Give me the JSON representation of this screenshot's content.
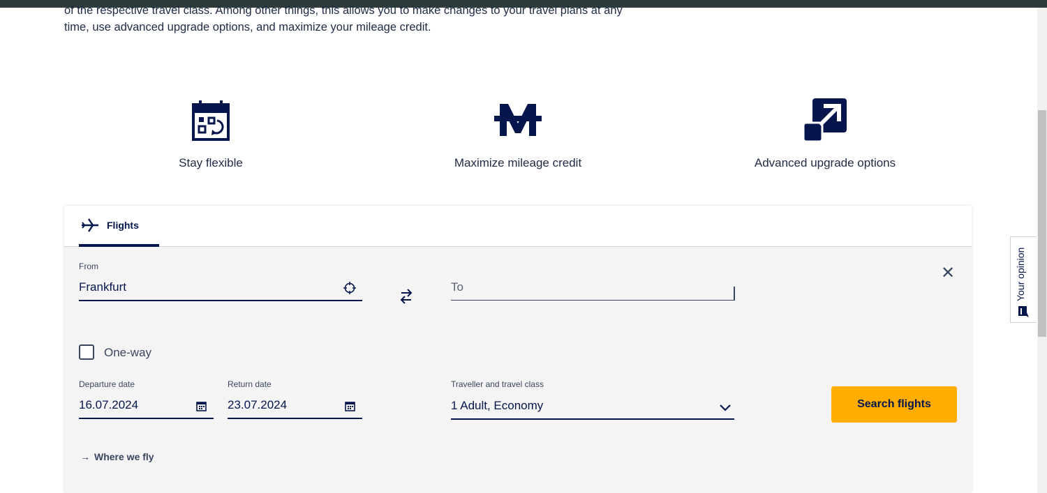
{
  "intro_text_line1": "of the respective travel class. Among other things, this allows you to make changes to your travel plans at any",
  "intro_text_line2": "time, use advanced upgrade options, and maximize your mileage credit.",
  "benefits": [
    {
      "label": "Stay flexible",
      "icon": "calendar-flex-icon"
    },
    {
      "label": "Maximize mileage credit",
      "icon": "miles-m-icon"
    },
    {
      "label": "Advanced upgrade options",
      "icon": "upgrade-arrow-icon"
    }
  ],
  "booking": {
    "tab_label": "Flights",
    "from_label": "From",
    "from_value": "Frankfurt",
    "to_placeholder": "To",
    "oneway_label": "One-way",
    "departure_label": "Departure date",
    "departure_value": "16.07.2024",
    "return_label": "Return date",
    "return_value": "23.07.2024",
    "traveller_label": "Traveller and travel class",
    "traveller_value": "1 Adult, Economy",
    "search_label": "Search flights",
    "where_label": "Where we fly",
    "close_glyph": "✕"
  },
  "feedback_label": "Your opinion",
  "colors": {
    "navy": "#05164d",
    "accent": "#ffad00",
    "panel": "#f4f4f4"
  }
}
